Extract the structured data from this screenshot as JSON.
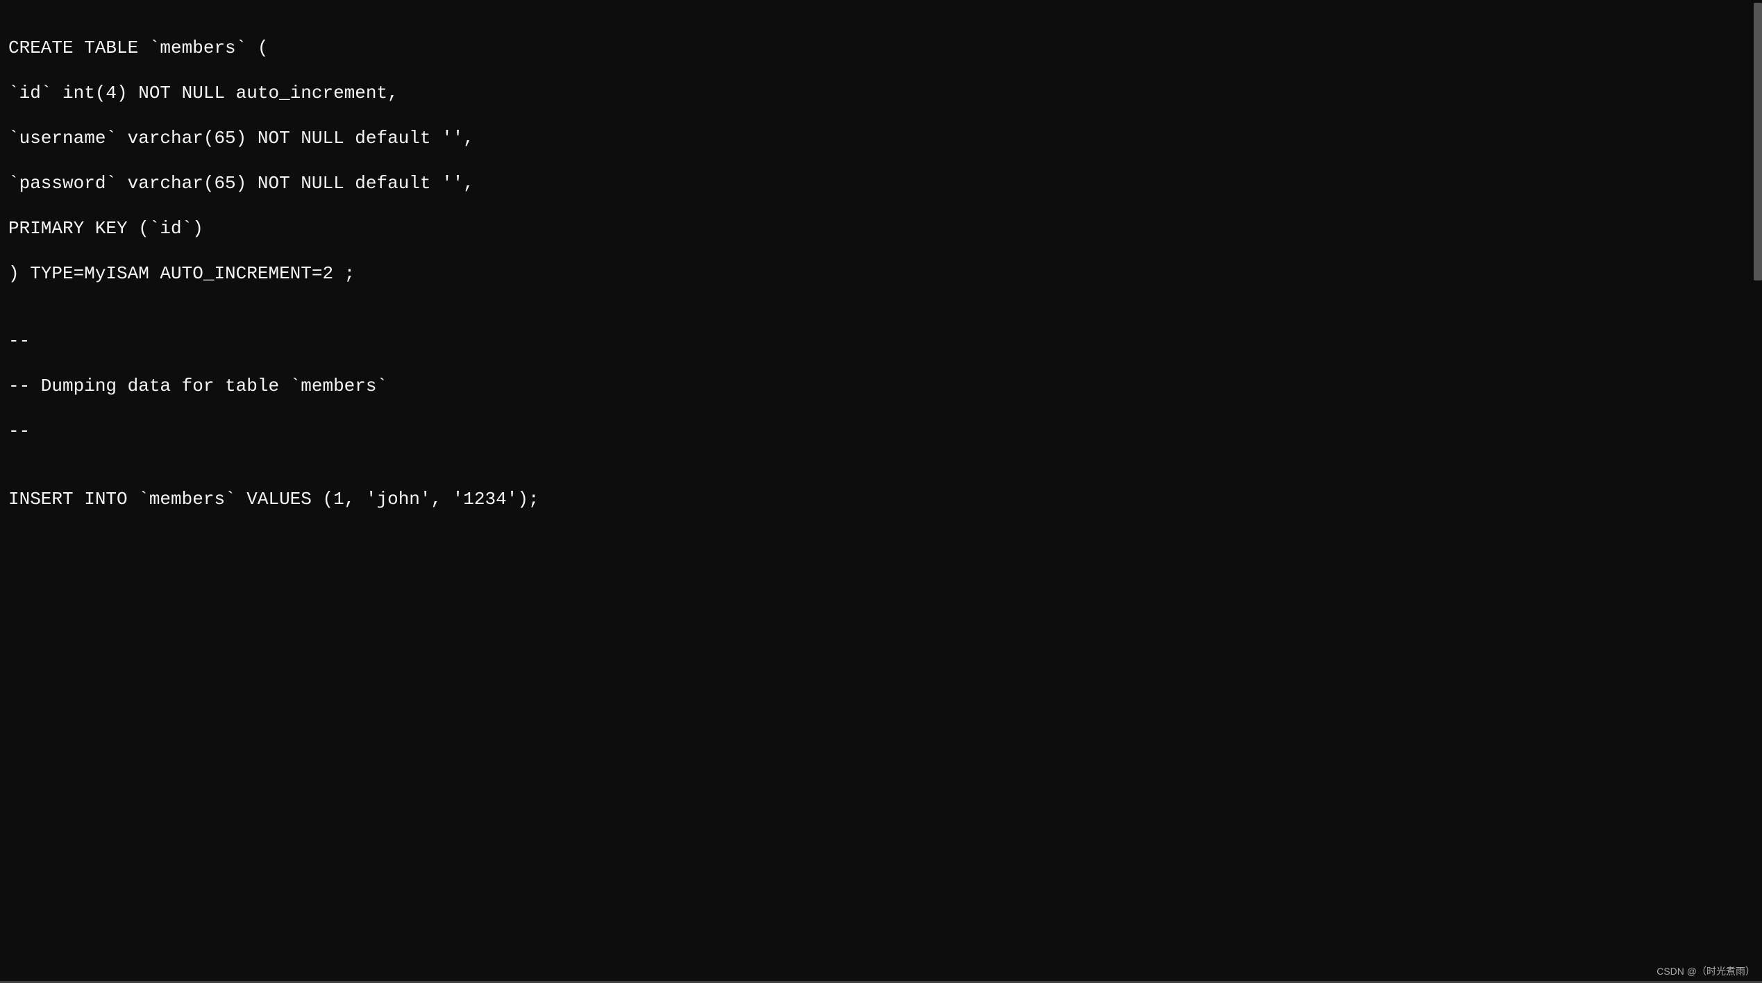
{
  "code": {
    "line1": "CREATE TABLE `members` (",
    "line2": "`id` int(4) NOT NULL auto_increment,",
    "line3": "`username` varchar(65) NOT NULL default '',",
    "line4": "`password` varchar(65) NOT NULL default '',",
    "line5": "PRIMARY KEY (`id`)",
    "line6": ") TYPE=MyISAM AUTO_INCREMENT=2 ;",
    "line7": "",
    "line8": "--",
    "line9": "-- Dumping data for table `members`",
    "line10": "--",
    "line11": "",
    "line12": "INSERT INTO `members` VALUES (1, 'john', '1234');"
  },
  "watermark": "CSDN @（时光煮雨）"
}
